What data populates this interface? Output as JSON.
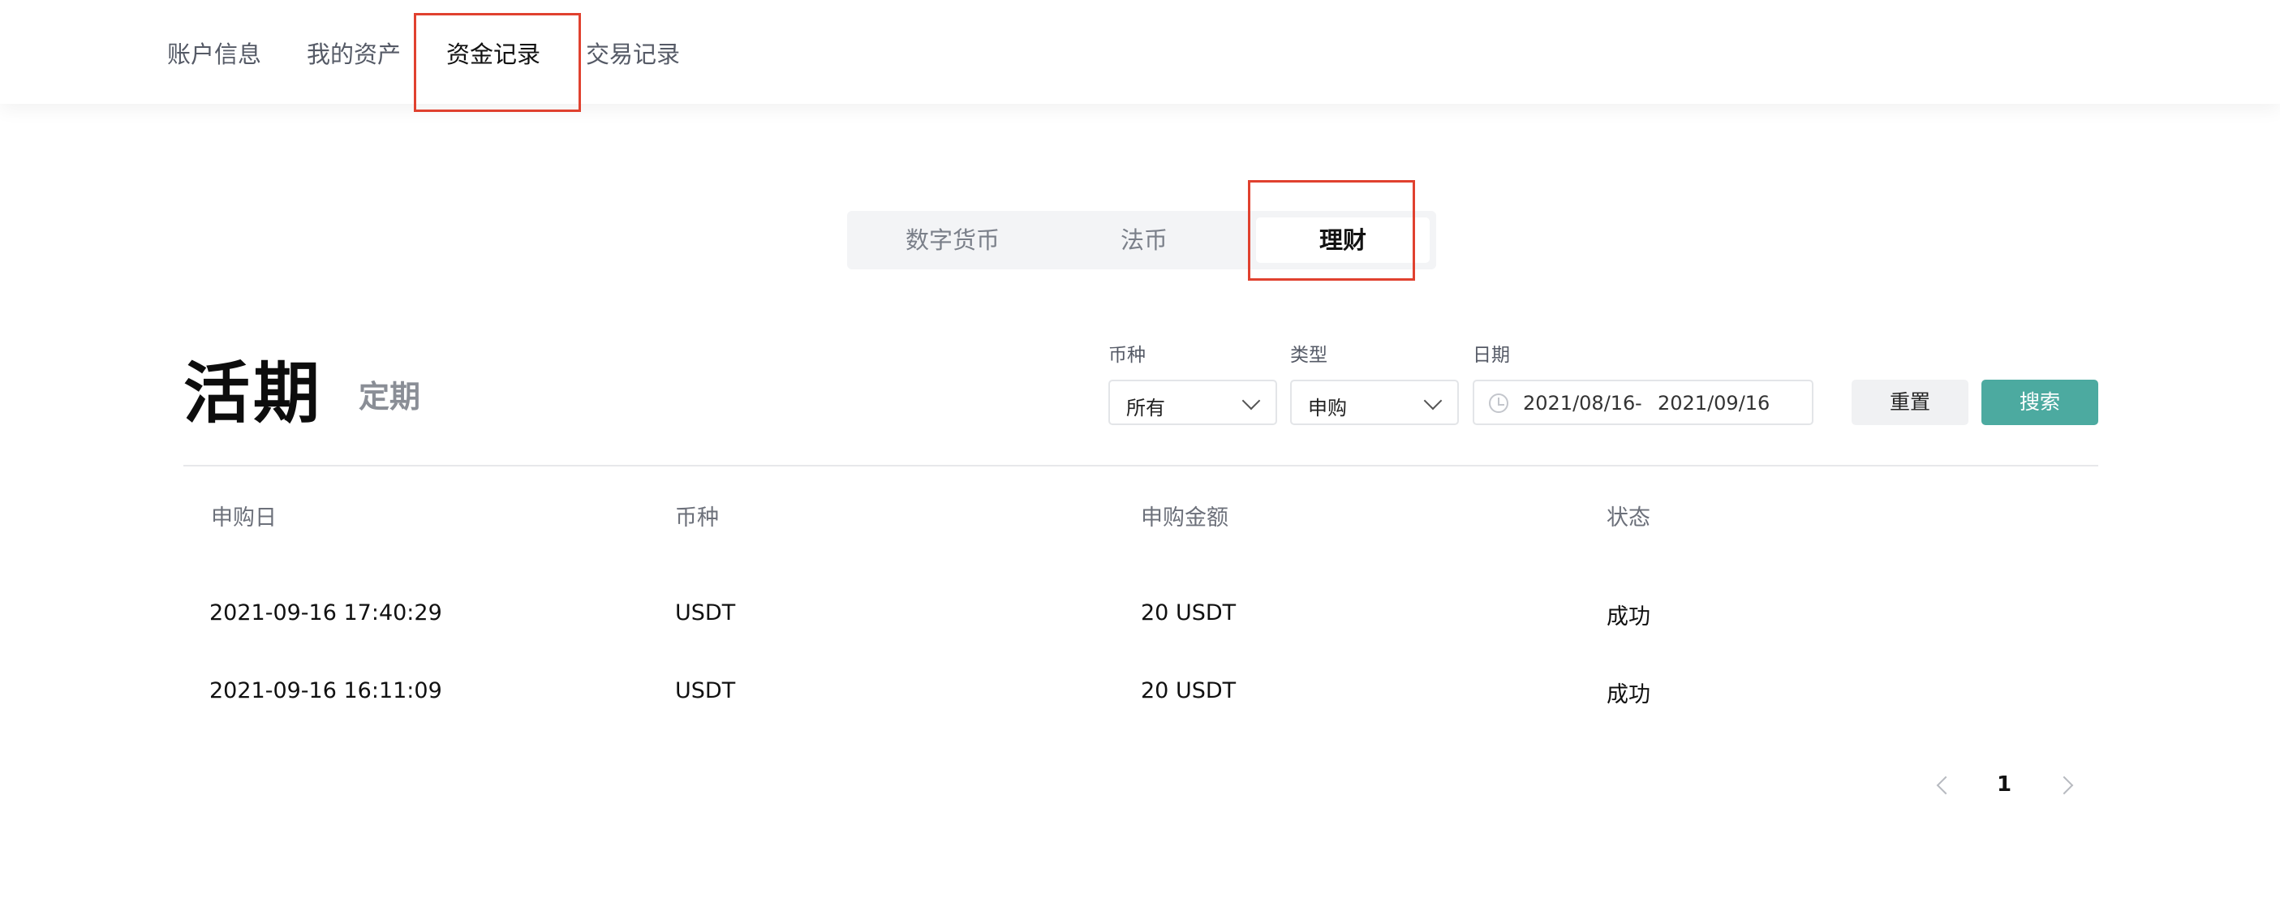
{
  "topnav": {
    "items": [
      {
        "label": "账户信息",
        "active": false
      },
      {
        "label": "我的资产",
        "active": false
      },
      {
        "label": "资金记录",
        "active": true
      },
      {
        "label": "交易记录",
        "active": false
      }
    ]
  },
  "segment": {
    "tabs": [
      {
        "label": "数字货币",
        "active": false
      },
      {
        "label": "法币",
        "active": false
      },
      {
        "label": "理财",
        "active": true
      }
    ]
  },
  "section": {
    "title": "活期",
    "alt_title": "定期"
  },
  "filters": {
    "currency": {
      "label": "币种",
      "value": "所有"
    },
    "type": {
      "label": "类型",
      "value": "申购"
    },
    "date": {
      "label": "日期",
      "start": "2021/08/16",
      "separator": "-",
      "end": "2021/09/16"
    },
    "reset_label": "重置",
    "search_label": "搜索"
  },
  "table": {
    "columns": [
      "申购日",
      "币种",
      "申购金额",
      "状态"
    ],
    "rows": [
      [
        "2021-09-16 17:40:29",
        "USDT",
        "20 USDT",
        "成功"
      ],
      [
        "2021-09-16 16:11:09",
        "USDT",
        "20 USDT",
        "成功"
      ]
    ]
  },
  "pagination": {
    "current": "1"
  },
  "colors": {
    "accent": "#4caaa0",
    "highlight_box": "#e0412f"
  }
}
